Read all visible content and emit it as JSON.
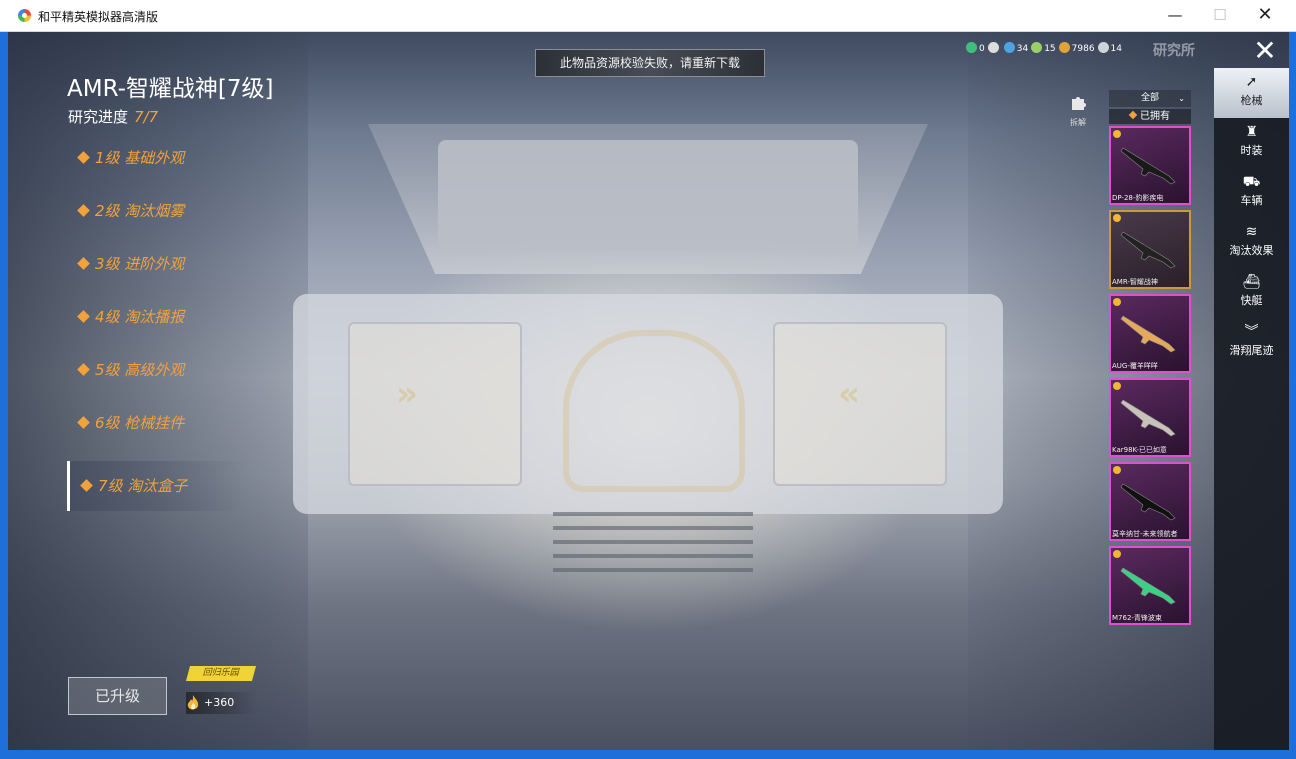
{
  "window": {
    "title": "和平精英模拟器高清版",
    "min_label": "—",
    "max_label": "☐",
    "close_label": "✕"
  },
  "notice": "此物品资源校验失败，请重新下载",
  "weapon": {
    "title": "AMR-智耀战神[7级]",
    "progress_label": "研究进度",
    "progress_value": "7/7"
  },
  "levels": [
    {
      "label": "1级 基础外观"
    },
    {
      "label": "2级 淘汰烟雾"
    },
    {
      "label": "3级 进阶外观"
    },
    {
      "label": "4级 淘汰播报"
    },
    {
      "label": "5级 高级外观"
    },
    {
      "label": "6级 枪械挂件"
    },
    {
      "label": "7级 淘汰盒子"
    }
  ],
  "active_level_index": 6,
  "upgrade_button": "已升级",
  "reward": {
    "tag": "回归乐园",
    "points": "+360"
  },
  "currency": [
    {
      "icon": "green-gem-icon",
      "value": "0",
      "color": "#3fbf7f"
    },
    {
      "icon": "clock-icon",
      "value": "",
      "color": "#dddddd"
    },
    {
      "icon": "globe-icon",
      "value": "34",
      "color": "#4fa3e0"
    },
    {
      "icon": "laurel-icon",
      "value": "15",
      "color": "#9ccf6a"
    },
    {
      "icon": "coin-icon",
      "value": "7986",
      "color": "#e0a33a"
    },
    {
      "icon": "ticket-icon",
      "value": "14",
      "color": "#cfd4da"
    }
  ],
  "lab_label": "研究所",
  "close_label": "✕",
  "decompose_label": "拆解",
  "filter": {
    "selected": "全部",
    "arrow": "⌄"
  },
  "owned_label": "已拥有",
  "items": [
    {
      "name": "DP-28-豹影疾电",
      "color": "#1a1a1a"
    },
    {
      "name": "AMR-智耀战神",
      "color": "#222222"
    },
    {
      "name": "AUG-覆羊咩咩",
      "color": "#e4a95a"
    },
    {
      "name": "Kar98K-已已如意",
      "color": "#c9c2b8"
    },
    {
      "name": "莫辛纳甘-未来领航者",
      "color": "#111111"
    },
    {
      "name": "M762-青锋波束",
      "color": "#3ecf86"
    }
  ],
  "selected_item_index": 1,
  "nav": [
    {
      "label": "枪械",
      "icon": "gun-icon",
      "glyph": "➚"
    },
    {
      "label": "时装",
      "icon": "outfit-icon",
      "glyph": "♜"
    },
    {
      "label": "车辆",
      "icon": "car-icon",
      "glyph": "⛟"
    },
    {
      "label": "淘汰效果",
      "icon": "effect-icon",
      "glyph": "≋"
    },
    {
      "label": "快艇",
      "icon": "boat-icon",
      "glyph": "⛴"
    },
    {
      "label": "滑翔尾迹",
      "icon": "glider-icon",
      "glyph": "︾"
    }
  ],
  "active_nav_index": 0
}
